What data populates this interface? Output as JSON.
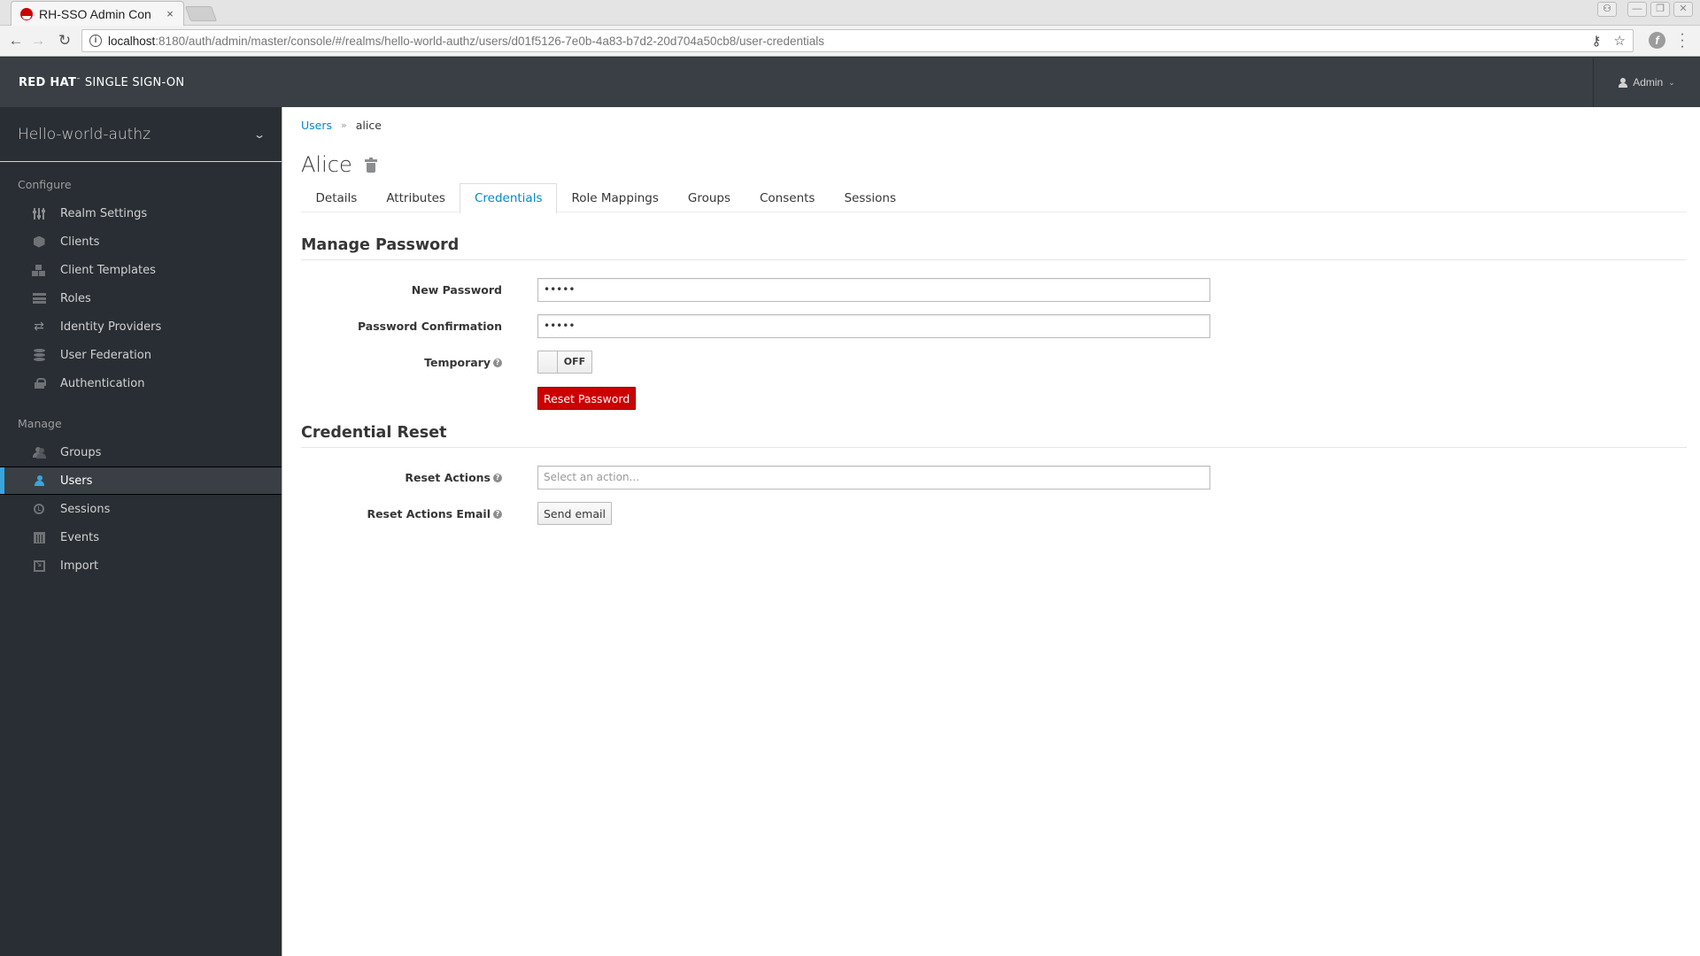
{
  "browser": {
    "tab_title": "RH-SSO Admin Con",
    "tab_close": "×",
    "url_host": "localhost",
    "url_rest": ":8180/auth/admin/master/console/#/realms/hello-world-authz/users/d01f5126-7e0b-4a83-b7d2-20d704a50cb8/user-credentials",
    "icons": {
      "back": "←",
      "forward": "→",
      "reload": "↻",
      "info": "i",
      "key": "⚷",
      "star": "☆",
      "extension": "f",
      "menu": "⋮",
      "minimize": "—",
      "restore": "❐",
      "close": "✕",
      "profile": "👤"
    }
  },
  "header": {
    "brand_bold": "RED HAT",
    "brand_rest": "SINGLE SIGN-ON",
    "user_label": "Admin",
    "caret": "⌄"
  },
  "sidebar": {
    "realm": "Hello-world-authz",
    "realm_chevron": "⌄",
    "configure_title": "Configure",
    "configure_items": [
      {
        "label": "Realm Settings",
        "icon": "sliders-icon"
      },
      {
        "label": "Clients",
        "icon": "cube-icon"
      },
      {
        "label": "Client Templates",
        "icon": "cubes-icon"
      },
      {
        "label": "Roles",
        "icon": "server-icon"
      },
      {
        "label": "Identity Providers",
        "icon": "exchange-icon"
      },
      {
        "label": "User Federation",
        "icon": "database-icon"
      },
      {
        "label": "Authentication",
        "icon": "lock-icon"
      }
    ],
    "manage_title": "Manage",
    "manage_items": [
      {
        "label": "Groups",
        "icon": "users-icon"
      },
      {
        "label": "Users",
        "icon": "user-icon",
        "active": true
      },
      {
        "label": "Sessions",
        "icon": "clock-icon"
      },
      {
        "label": "Events",
        "icon": "calendar-icon"
      },
      {
        "label": "Import",
        "icon": "import-icon"
      }
    ],
    "accent_color": "#39a5dc"
  },
  "main": {
    "breadcrumb": {
      "parent": "Users",
      "separator": "»",
      "current": "alice"
    },
    "title": "Alice",
    "tabs": [
      {
        "label": "Details"
      },
      {
        "label": "Attributes"
      },
      {
        "label": "Credentials",
        "active": true
      },
      {
        "label": "Role Mappings"
      },
      {
        "label": "Groups"
      },
      {
        "label": "Consents"
      },
      {
        "label": "Sessions"
      }
    ],
    "manage_password": {
      "title": "Manage Password",
      "new_password_label": "New Password",
      "new_password_value": "•••••",
      "confirmation_label": "Password Confirmation",
      "confirmation_value": "•••••",
      "temporary_label": "Temporary",
      "temporary_state": "OFF",
      "reset_button": "Reset Password"
    },
    "credential_reset": {
      "title": "Credential Reset",
      "reset_actions_label": "Reset Actions",
      "reset_actions_placeholder": "Select an action...",
      "email_label": "Reset Actions Email",
      "send_email_button": "Send email"
    },
    "help_glyph": "?",
    "link_color": "#0088ce",
    "danger_color": "#cc0000"
  }
}
